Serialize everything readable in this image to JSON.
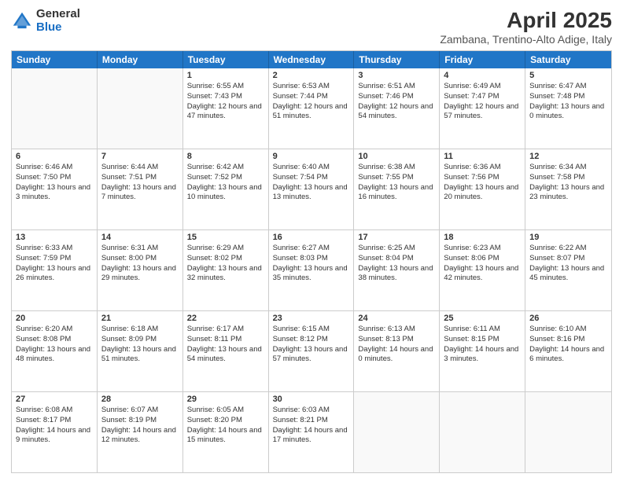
{
  "header": {
    "logo": {
      "general": "General",
      "blue": "Blue"
    },
    "title": "April 2025",
    "location": "Zambana, Trentino-Alto Adige, Italy"
  },
  "weekdays": [
    "Sunday",
    "Monday",
    "Tuesday",
    "Wednesday",
    "Thursday",
    "Friday",
    "Saturday"
  ],
  "rows": [
    [
      {
        "day": "",
        "sunrise": "",
        "sunset": "",
        "daylight": ""
      },
      {
        "day": "",
        "sunrise": "",
        "sunset": "",
        "daylight": ""
      },
      {
        "day": "1",
        "sunrise": "Sunrise: 6:55 AM",
        "sunset": "Sunset: 7:43 PM",
        "daylight": "Daylight: 12 hours and 47 minutes."
      },
      {
        "day": "2",
        "sunrise": "Sunrise: 6:53 AM",
        "sunset": "Sunset: 7:44 PM",
        "daylight": "Daylight: 12 hours and 51 minutes."
      },
      {
        "day": "3",
        "sunrise": "Sunrise: 6:51 AM",
        "sunset": "Sunset: 7:46 PM",
        "daylight": "Daylight: 12 hours and 54 minutes."
      },
      {
        "day": "4",
        "sunrise": "Sunrise: 6:49 AM",
        "sunset": "Sunset: 7:47 PM",
        "daylight": "Daylight: 12 hours and 57 minutes."
      },
      {
        "day": "5",
        "sunrise": "Sunrise: 6:47 AM",
        "sunset": "Sunset: 7:48 PM",
        "daylight": "Daylight: 13 hours and 0 minutes."
      }
    ],
    [
      {
        "day": "6",
        "sunrise": "Sunrise: 6:46 AM",
        "sunset": "Sunset: 7:50 PM",
        "daylight": "Daylight: 13 hours and 3 minutes."
      },
      {
        "day": "7",
        "sunrise": "Sunrise: 6:44 AM",
        "sunset": "Sunset: 7:51 PM",
        "daylight": "Daylight: 13 hours and 7 minutes."
      },
      {
        "day": "8",
        "sunrise": "Sunrise: 6:42 AM",
        "sunset": "Sunset: 7:52 PM",
        "daylight": "Daylight: 13 hours and 10 minutes."
      },
      {
        "day": "9",
        "sunrise": "Sunrise: 6:40 AM",
        "sunset": "Sunset: 7:54 PM",
        "daylight": "Daylight: 13 hours and 13 minutes."
      },
      {
        "day": "10",
        "sunrise": "Sunrise: 6:38 AM",
        "sunset": "Sunset: 7:55 PM",
        "daylight": "Daylight: 13 hours and 16 minutes."
      },
      {
        "day": "11",
        "sunrise": "Sunrise: 6:36 AM",
        "sunset": "Sunset: 7:56 PM",
        "daylight": "Daylight: 13 hours and 20 minutes."
      },
      {
        "day": "12",
        "sunrise": "Sunrise: 6:34 AM",
        "sunset": "Sunset: 7:58 PM",
        "daylight": "Daylight: 13 hours and 23 minutes."
      }
    ],
    [
      {
        "day": "13",
        "sunrise": "Sunrise: 6:33 AM",
        "sunset": "Sunset: 7:59 PM",
        "daylight": "Daylight: 13 hours and 26 minutes."
      },
      {
        "day": "14",
        "sunrise": "Sunrise: 6:31 AM",
        "sunset": "Sunset: 8:00 PM",
        "daylight": "Daylight: 13 hours and 29 minutes."
      },
      {
        "day": "15",
        "sunrise": "Sunrise: 6:29 AM",
        "sunset": "Sunset: 8:02 PM",
        "daylight": "Daylight: 13 hours and 32 minutes."
      },
      {
        "day": "16",
        "sunrise": "Sunrise: 6:27 AM",
        "sunset": "Sunset: 8:03 PM",
        "daylight": "Daylight: 13 hours and 35 minutes."
      },
      {
        "day": "17",
        "sunrise": "Sunrise: 6:25 AM",
        "sunset": "Sunset: 8:04 PM",
        "daylight": "Daylight: 13 hours and 38 minutes."
      },
      {
        "day": "18",
        "sunrise": "Sunrise: 6:23 AM",
        "sunset": "Sunset: 8:06 PM",
        "daylight": "Daylight: 13 hours and 42 minutes."
      },
      {
        "day": "19",
        "sunrise": "Sunrise: 6:22 AM",
        "sunset": "Sunset: 8:07 PM",
        "daylight": "Daylight: 13 hours and 45 minutes."
      }
    ],
    [
      {
        "day": "20",
        "sunrise": "Sunrise: 6:20 AM",
        "sunset": "Sunset: 8:08 PM",
        "daylight": "Daylight: 13 hours and 48 minutes."
      },
      {
        "day": "21",
        "sunrise": "Sunrise: 6:18 AM",
        "sunset": "Sunset: 8:09 PM",
        "daylight": "Daylight: 13 hours and 51 minutes."
      },
      {
        "day": "22",
        "sunrise": "Sunrise: 6:17 AM",
        "sunset": "Sunset: 8:11 PM",
        "daylight": "Daylight: 13 hours and 54 minutes."
      },
      {
        "day": "23",
        "sunrise": "Sunrise: 6:15 AM",
        "sunset": "Sunset: 8:12 PM",
        "daylight": "Daylight: 13 hours and 57 minutes."
      },
      {
        "day": "24",
        "sunrise": "Sunrise: 6:13 AM",
        "sunset": "Sunset: 8:13 PM",
        "daylight": "Daylight: 14 hours and 0 minutes."
      },
      {
        "day": "25",
        "sunrise": "Sunrise: 6:11 AM",
        "sunset": "Sunset: 8:15 PM",
        "daylight": "Daylight: 14 hours and 3 minutes."
      },
      {
        "day": "26",
        "sunrise": "Sunrise: 6:10 AM",
        "sunset": "Sunset: 8:16 PM",
        "daylight": "Daylight: 14 hours and 6 minutes."
      }
    ],
    [
      {
        "day": "27",
        "sunrise": "Sunrise: 6:08 AM",
        "sunset": "Sunset: 8:17 PM",
        "daylight": "Daylight: 14 hours and 9 minutes."
      },
      {
        "day": "28",
        "sunrise": "Sunrise: 6:07 AM",
        "sunset": "Sunset: 8:19 PM",
        "daylight": "Daylight: 14 hours and 12 minutes."
      },
      {
        "day": "29",
        "sunrise": "Sunrise: 6:05 AM",
        "sunset": "Sunset: 8:20 PM",
        "daylight": "Daylight: 14 hours and 15 minutes."
      },
      {
        "day": "30",
        "sunrise": "Sunrise: 6:03 AM",
        "sunset": "Sunset: 8:21 PM",
        "daylight": "Daylight: 14 hours and 17 minutes."
      },
      {
        "day": "",
        "sunrise": "",
        "sunset": "",
        "daylight": ""
      },
      {
        "day": "",
        "sunrise": "",
        "sunset": "",
        "daylight": ""
      },
      {
        "day": "",
        "sunrise": "",
        "sunset": "",
        "daylight": ""
      }
    ]
  ]
}
